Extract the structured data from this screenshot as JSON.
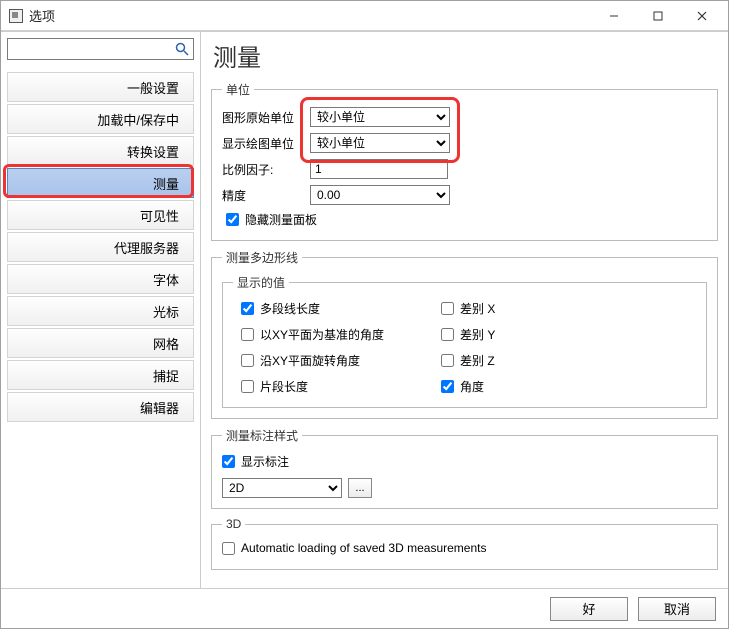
{
  "window": {
    "title": "选项"
  },
  "sidebar": {
    "search_placeholder": "",
    "items": [
      {
        "label": "一般设置"
      },
      {
        "label": "加载中/保存中"
      },
      {
        "label": "转换设置"
      },
      {
        "label": "测量",
        "selected": true
      },
      {
        "label": "可见性"
      },
      {
        "label": "代理服务器"
      },
      {
        "label": "字体"
      },
      {
        "label": "光标"
      },
      {
        "label": "网格"
      },
      {
        "label": "捕捉"
      },
      {
        "label": "编辑器"
      }
    ]
  },
  "main": {
    "title": "测量",
    "units": {
      "legend": "单位",
      "original_units_label": "图形原始单位",
      "original_units_value": "较小单位",
      "display_units_label": "显示绘图单位",
      "display_units_value": "较小单位",
      "scale_factor_label": "比例因子:",
      "scale_factor_value": "1",
      "precision_label": "精度",
      "precision_value": "0.00",
      "hide_panel_label": "隐藏测量面板",
      "hide_panel_checked": true
    },
    "polyline": {
      "legend": "测量多边形线",
      "values_legend": "显示的值",
      "checks": {
        "multiseg_len": {
          "label": "多段线长度",
          "checked": true
        },
        "diff_x": {
          "label": "差别 X",
          "checked": false
        },
        "xy_plane_angle": {
          "label": "以XY平面为基准的角度",
          "checked": false
        },
        "diff_y": {
          "label": "差别 Y",
          "checked": false
        },
        "rot_xy_angle": {
          "label": "沿XY平面旋转角度",
          "checked": false
        },
        "diff_z": {
          "label": "差别 Z",
          "checked": false
        },
        "segment_len": {
          "label": "片段长度",
          "checked": false
        },
        "angle": {
          "label": "角度",
          "checked": true
        }
      }
    },
    "annotation": {
      "legend": "测量标注样式",
      "show_label": "显示标注",
      "show_checked": true,
      "mode_value": "2D",
      "dots_label": "..."
    },
    "threeD": {
      "legend": "3D",
      "autoload_label": "Automatic loading of saved 3D measurements",
      "autoload_checked": false
    }
  },
  "footer": {
    "ok": "好",
    "cancel": "取消"
  }
}
